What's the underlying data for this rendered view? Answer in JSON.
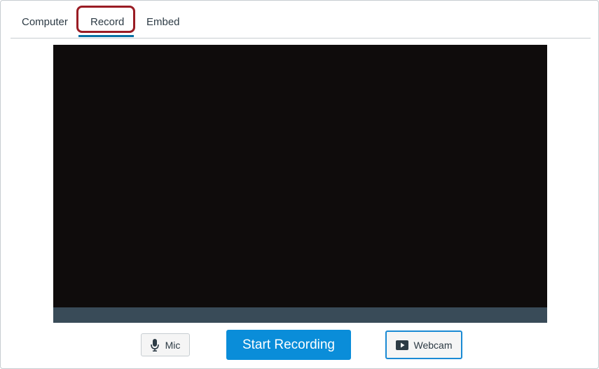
{
  "tabs": [
    {
      "label": "Computer",
      "selected": false
    },
    {
      "label": "Record",
      "selected": true
    },
    {
      "label": "Embed",
      "selected": false
    }
  ],
  "controls": {
    "mic_label": "Mic",
    "start_label": "Start Recording",
    "webcam_label": "Webcam"
  },
  "icons": {
    "mic": "microphone-icon",
    "webcam": "play-video-icon"
  },
  "colors": {
    "accent": "#0a8dd9",
    "tab_underline": "#0770a3",
    "highlight_border": "#9a1c24",
    "video_background": "#0f0c0c",
    "video_bar": "#394b58",
    "text": "#2d3b45"
  }
}
